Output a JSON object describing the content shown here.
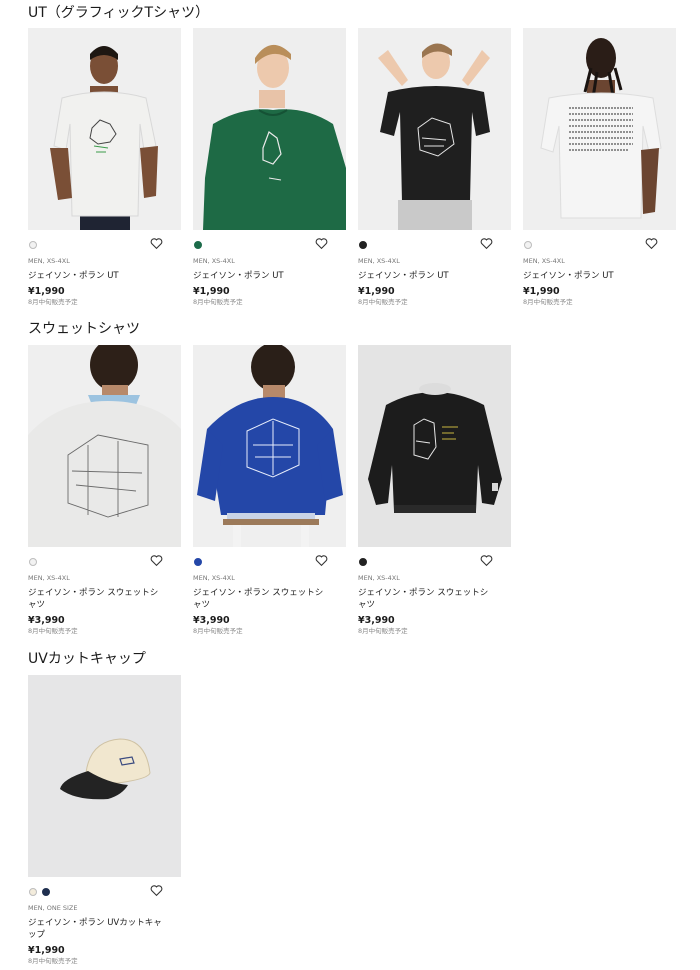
{
  "sections": [
    {
      "title": "UT（グラフィックTシャツ）",
      "products": [
        {
          "gender_size": "MEN, XS-4XL",
          "name": "ジェイソン・ポラン UT",
          "price": "¥1,990",
          "note": "8月中旬販売予定",
          "colors": [
            "#f2f2f2"
          ]
        },
        {
          "gender_size": "MEN, XS-4XL",
          "name": "ジェイソン・ポラン UT",
          "price": "¥1,990",
          "note": "8月中旬販売予定",
          "colors": [
            "#1c6b4a"
          ]
        },
        {
          "gender_size": "MEN, XS-4XL",
          "name": "ジェイソン・ポラン UT",
          "price": "¥1,990",
          "note": "8月中旬販売予定",
          "colors": [
            "#222222"
          ]
        },
        {
          "gender_size": "MEN, XS-4XL",
          "name": "ジェイソン・ポラン UT",
          "price": "¥1,990",
          "note": "8月中旬販売予定",
          "colors": [
            "#f2f2f2"
          ]
        }
      ]
    },
    {
      "title": "スウェットシャツ",
      "products": [
        {
          "gender_size": "MEN, XS-4XL",
          "name": "ジェイソン・ポラン スウェットシャツ",
          "price": "¥3,990",
          "note": "8月中旬販売予定",
          "colors": [
            "#f2f2f2"
          ]
        },
        {
          "gender_size": "MEN, XS-4XL",
          "name": "ジェイソン・ポラン スウェットシャツ",
          "price": "¥3,990",
          "note": "8月中旬販売予定",
          "colors": [
            "#2447a8"
          ]
        },
        {
          "gender_size": "MEN, XS-4XL",
          "name": "ジェイソン・ポラン スウェットシャツ",
          "price": "¥3,990",
          "note": "8月中旬販売予定",
          "colors": [
            "#222222"
          ]
        }
      ]
    },
    {
      "title": "UVカットキャップ",
      "products": [
        {
          "gender_size": "MEN, ONE SIZE",
          "name": "ジェイソン・ポラン UVカットキャップ",
          "price": "¥1,990",
          "note": "8月中旬販売予定",
          "colors": [
            "#f3ecdc",
            "#1f2f4f"
          ]
        }
      ]
    }
  ]
}
